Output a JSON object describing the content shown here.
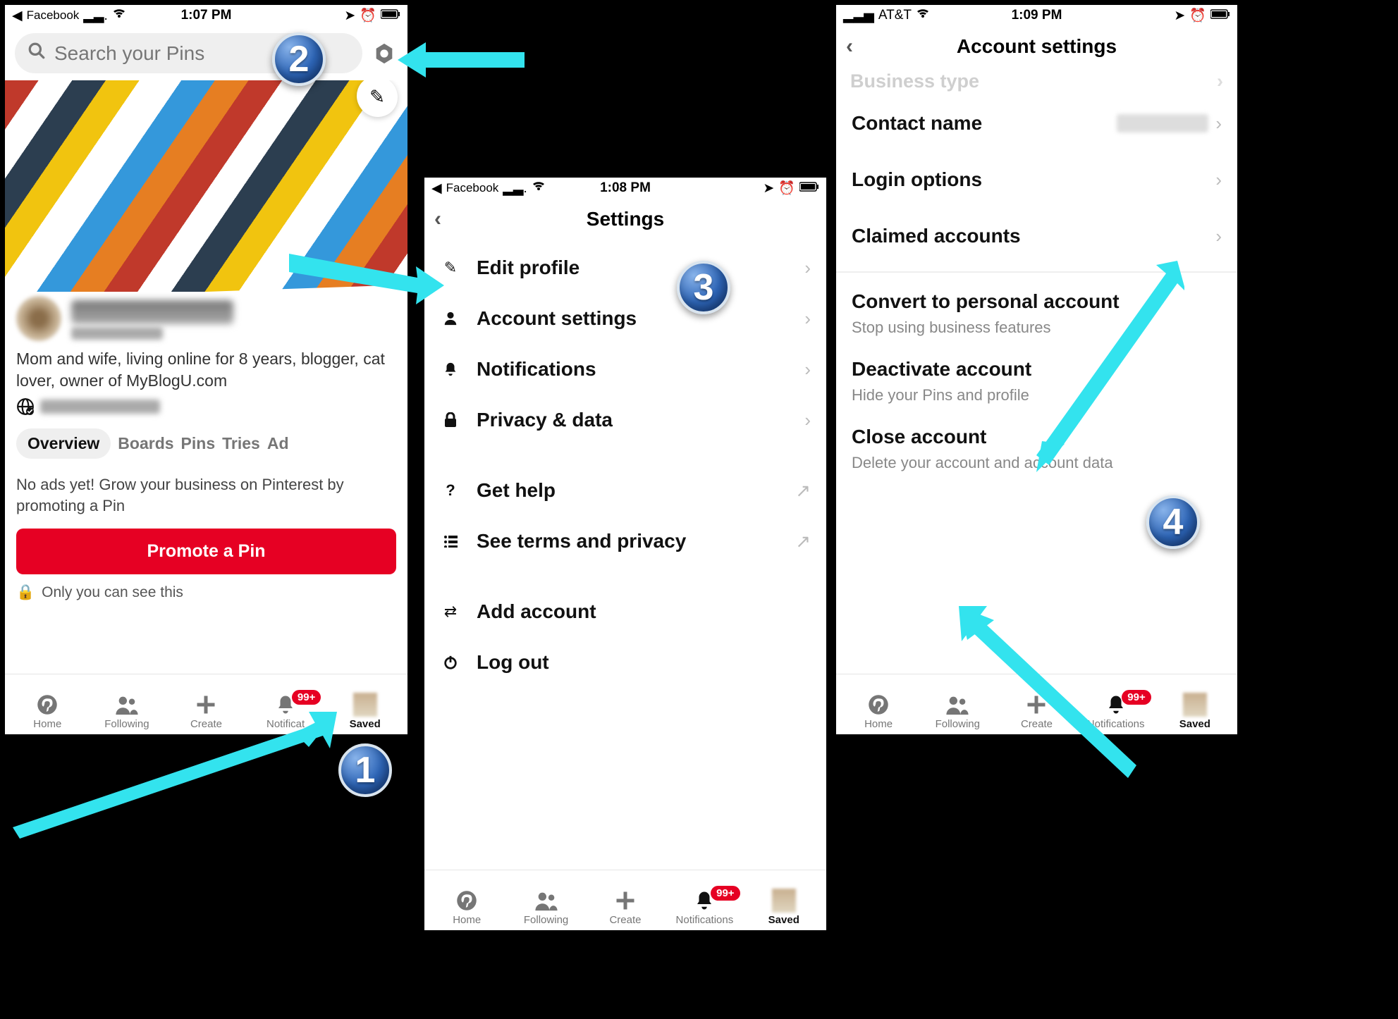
{
  "phone1": {
    "status": {
      "back_app": "Facebook",
      "time": "1:07 PM"
    },
    "search_placeholder": "Search your Pins",
    "bio": "Mom and wife, living online for 8 years, blogger, cat lover, owner of MyBlogU.com",
    "tabs": {
      "overview": "Overview",
      "boards": "Boards",
      "pins": "Pins",
      "tries": "Tries",
      "ads": "Ad"
    },
    "no_ads": "No ads yet! Grow your business on Pinterest by promoting a Pin",
    "promote_btn": "Promote a Pin",
    "lock_note": "Only you can see this",
    "tabbar": {
      "home": "Home",
      "following": "Following",
      "create": "Create",
      "notifications": "Notificat",
      "saved": "Saved",
      "badge": "99+"
    }
  },
  "phone2": {
    "status": {
      "back_app": "Facebook",
      "time": "1:08 PM"
    },
    "title": "Settings",
    "items": {
      "edit_profile": "Edit profile",
      "account_settings": "Account settings",
      "notifications": "Notifications",
      "privacy": "Privacy & data",
      "get_help": "Get help",
      "terms": "See terms and privacy",
      "add_account": "Add account",
      "log_out": "Log out"
    },
    "tabbar": {
      "home": "Home",
      "following": "Following",
      "create": "Create",
      "notifications": "Notifications",
      "saved": "Saved",
      "badge": "99+"
    }
  },
  "phone3": {
    "status": {
      "carrier": "AT&T",
      "time": "1:09 PM"
    },
    "title": "Account settings",
    "faded_row": "Business type",
    "rows": {
      "contact": "Contact name",
      "login": "Login options",
      "claimed": "Claimed accounts"
    },
    "convert": {
      "title": "Convert to personal account",
      "sub": "Stop using business features"
    },
    "deactivate": {
      "title": "Deactivate account",
      "sub": "Hide your Pins and profile"
    },
    "close": {
      "title": "Close account",
      "sub": "Delete your account and account data"
    },
    "tabbar": {
      "home": "Home",
      "following": "Following",
      "create": "Create",
      "notifications": "Notifications",
      "saved": "Saved",
      "badge": "99+"
    }
  },
  "annotations": {
    "n1": "1",
    "n2": "2",
    "n3": "3",
    "n4": "4"
  }
}
